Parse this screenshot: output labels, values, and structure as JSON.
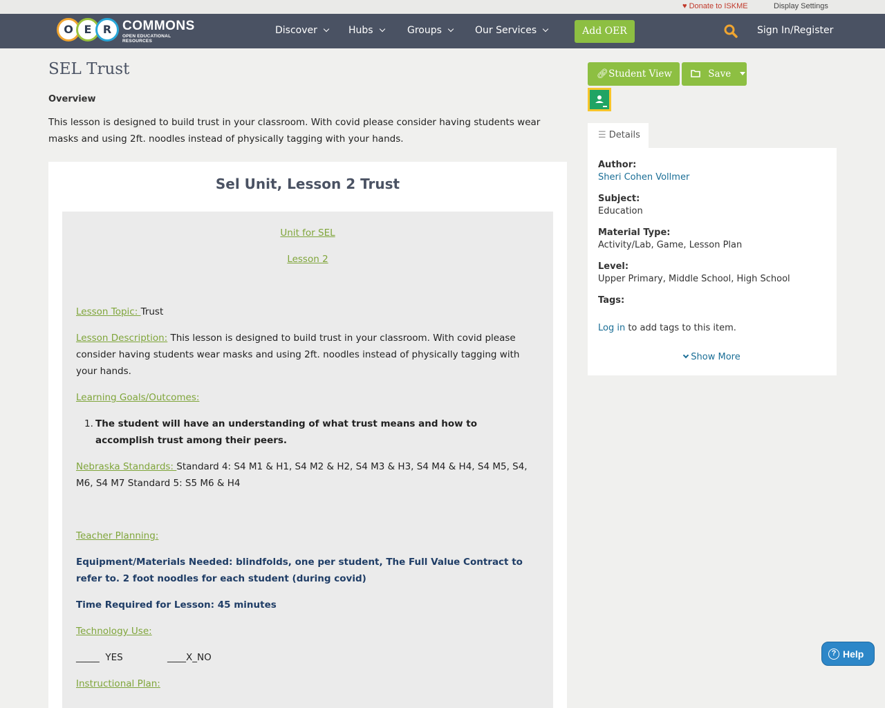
{
  "utility": {
    "donate_label": "Donate to ISKME",
    "display_settings_label": "Display Settings"
  },
  "nav": {
    "logo_letters": [
      "O",
      "E",
      "R"
    ],
    "logo_wordmark": "COMMONS",
    "logo_subtitle": "OPEN EDUCATIONAL RESOURCES",
    "items": [
      "Discover",
      "Hubs",
      "Groups",
      "Our Services"
    ],
    "add_oer_label": "Add OER",
    "sign_in_label": "Sign In/Register"
  },
  "page": {
    "title": "SEL Trust",
    "overview_heading": "Overview",
    "overview_text": "This lesson is designed to build trust in your classroom.  With covid please consider having students wear masks and using 2ft. noodles instead of physically tagging with your hands."
  },
  "content": {
    "heading": "Sel Unit, Lesson 2 Trust",
    "unit_link": "Unit for SEL",
    "lesson_link": "Lesson 2",
    "topic_label": "Lesson Topic: ",
    "topic_value": "Trust",
    "description_label": "Lesson Description:",
    "description_value": " This lesson is designed to build trust in your classroom.  With covid please consider having students wear masks and using 2ft. noodles instead of physically tagging with your hands.",
    "goals_label": "Learning Goals/Outcomes:",
    "goal_number": "1.",
    "goal_1": "The student will have an understanding of what trust means and how to accomplish trust among their peers.",
    "standards_label": "Nebraska Standards: ",
    "standards_value": "Standard 4: S4 M1 & H1, S4 M2 & H2, S4 M3 & H3, S4 M4 & H4, S4 M5, S4, M6, S4 M7  Standard 5: S5 M6 & H4",
    "planning_label": "Teacher Planning:",
    "equipment": "Equipment/Materials Needed: blindfolds, one per student, The Full Value Contract to refer to. 2 foot noodles for each student (during covid)",
    "time_required": "Time Required for Lesson: 45 minutes",
    "technology_label": "Technology Use:",
    "technology_options": "_____  YES               ____X_NO",
    "instructional_label": "Instructional Plan:"
  },
  "sidebar": {
    "student_view_label": "Student View",
    "save_label": "Save",
    "details_tab_label": "Details",
    "author_label": "Author:",
    "author_value": "Sheri Cohen Vollmer",
    "subject_label": "Subject:",
    "subject_value": "Education",
    "material_type_label": "Material Type:",
    "material_type_value": "Activity/Lab, Game, Lesson Plan",
    "level_label": "Level:",
    "level_value": "Upper Primary, Middle School, High School",
    "tags_label": "Tags:",
    "login_link": "Log in",
    "tags_note": " to add tags to this item.",
    "show_more_label": "Show More"
  },
  "help": {
    "label": "Help"
  },
  "colors": {
    "nav_bg": "#4a5263",
    "accent_green": "#8dbf42",
    "link_blue": "#1a6e96",
    "help_blue": "#2d87c8"
  }
}
